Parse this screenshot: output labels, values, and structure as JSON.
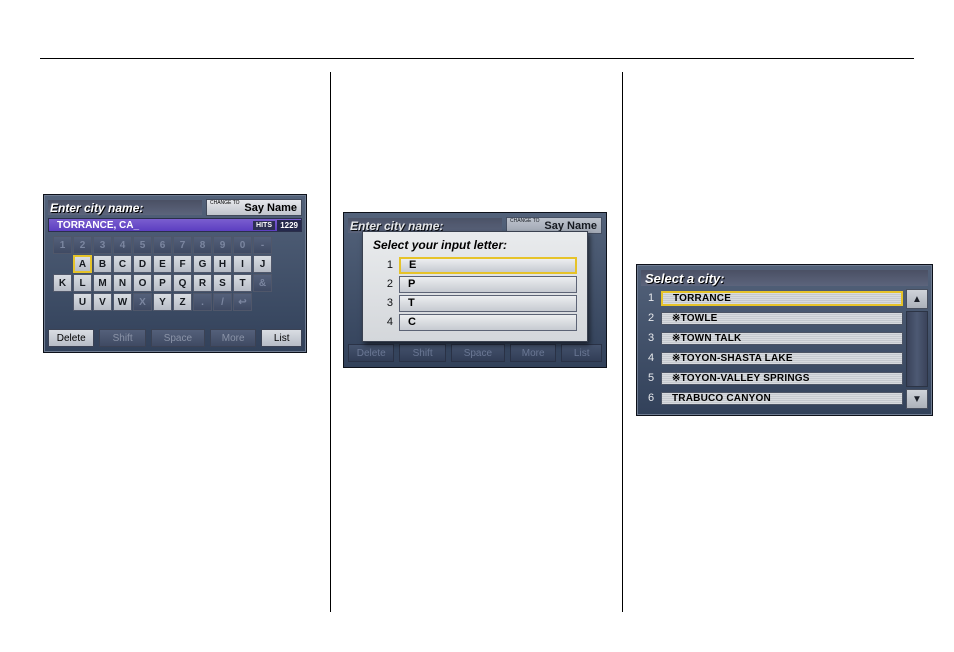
{
  "screen1": {
    "title": "Enter city name:",
    "say_change": "CHANGE\nTO",
    "say_name": "Say Name",
    "entry_text": "TORRANCE, CA_",
    "hits_label": "HITS",
    "hits_value": "1229",
    "row_digits": [
      "1",
      "2",
      "3",
      "4",
      "5",
      "6",
      "7",
      "8",
      "9",
      "0",
      "-"
    ],
    "row_a": [
      "A",
      "B",
      "C",
      "D",
      "E",
      "F",
      "G",
      "H",
      "I",
      "J"
    ],
    "row_k": [
      "K",
      "L",
      "M",
      "N",
      "O",
      "P",
      "Q",
      "R",
      "S",
      "T",
      "&"
    ],
    "row_u": [
      "U",
      "V",
      "W",
      "X",
      "Y",
      "Z",
      ".",
      "/",
      "↩"
    ],
    "bottom": {
      "delete": "Delete",
      "shift": "Shift",
      "space": "Space",
      "more": "More",
      "list": "List"
    },
    "disabled_keys": [
      "1",
      "2",
      "3",
      "4",
      "5",
      "6",
      "7",
      "8",
      "9",
      "0",
      "-",
      "&",
      "X",
      ".",
      "/",
      "↩"
    ],
    "selected_key": "A"
  },
  "screen2": {
    "title": "Enter city name:",
    "say_change": "CHANGE\nTO",
    "say_name": "Say Name",
    "popup_title": "Select your input letter:",
    "options": [
      {
        "n": "1",
        "v": "E",
        "selected": true
      },
      {
        "n": "2",
        "v": "P",
        "selected": false
      },
      {
        "n": "3",
        "v": "T",
        "selected": false
      },
      {
        "n": "4",
        "v": "C",
        "selected": false
      }
    ],
    "bottom": {
      "delete": "Delete",
      "shift": "Shift",
      "space": "Space",
      "more": "More",
      "list": "List"
    }
  },
  "screen3": {
    "title": "Select a city:",
    "rows": [
      {
        "n": "1",
        "v": "  TORRANCE",
        "selected": true
      },
      {
        "n": "2",
        "v": "※TOWLE",
        "selected": false
      },
      {
        "n": "3",
        "v": "※TOWN TALK",
        "selected": false
      },
      {
        "n": "4",
        "v": "※TOYON-SHASTA LAKE",
        "selected": false
      },
      {
        "n": "5",
        "v": "※TOYON-VALLEY SPRINGS",
        "selected": false
      },
      {
        "n": "6",
        "v": "  TRABUCO CANYON",
        "selected": false
      }
    ],
    "scroll_up": "▲",
    "scroll_down": "▼"
  }
}
